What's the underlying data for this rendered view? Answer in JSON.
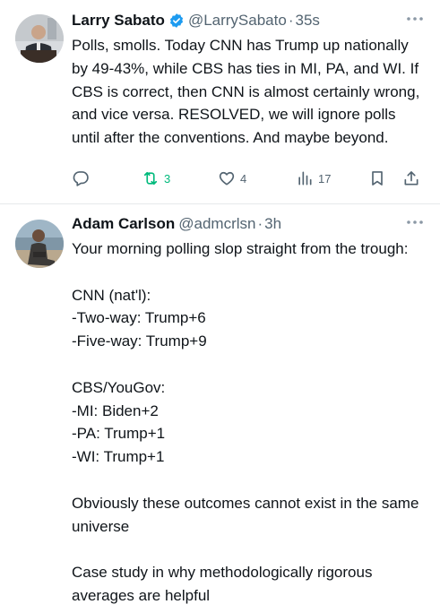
{
  "tweets": [
    {
      "name": "Larry Sabato",
      "handle": "@LarrySabato",
      "separator": "·",
      "time": "35s",
      "text": "Polls, smolls. Today CNN has Trump up nationally by 49-43%, while CBS has ties in MI, PA, and WI. If CBS is correct, then CNN is almost certainly wrong, and vice versa. RESOLVED, we will ignore polls until after the conventions. And maybe beyond.",
      "verified": true,
      "stats": {
        "reposts": "3",
        "likes": "4",
        "views": "17"
      },
      "icons": [
        "reply-icon",
        "repost-icon",
        "like-icon",
        "views-icon",
        "bookmark-icon",
        "share-icon"
      ]
    },
    {
      "name": "Adam Carlson",
      "handle": "@admcrlsn",
      "separator": "·",
      "time": "3h",
      "text": "Your morning polling slop straight from the trough:\n\nCNN (nat'l):\n-Two-way: Trump+6\n-Five-way: Trump+9\n\nCBS/YouGov:\n-MI: Biden+2\n-PA: Trump+1\n-WI: Trump+1\n\nObviously these outcomes cannot exist in the same universe\n\nCase study in why methodologically rigorous averages are helpful"
    }
  ],
  "colors": {
    "text": "#0f1419",
    "secondary": "#536471",
    "verified": "#1d9bf0",
    "repost_active": "#00ba7c",
    "divider": "#e6e9eb"
  }
}
